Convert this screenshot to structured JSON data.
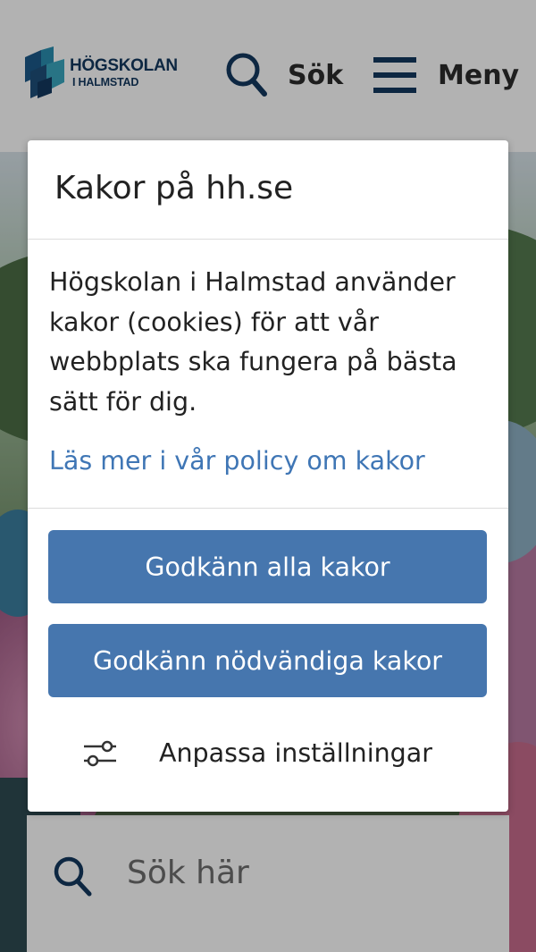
{
  "header": {
    "logo": {
      "line1": "HÖGSKOLAN",
      "line2": "I HALMSTAD"
    },
    "search_label": "Sök",
    "menu_label": "Meny"
  },
  "hero": {
    "search_placeholder": "Sök här"
  },
  "cookie_dialog": {
    "title": "Kakor på hh.se",
    "body": "Högskolan i Halmstad använder kakor (cookies) för att vår webbplats ska fungera på bästa sätt för dig.",
    "policy_link": "Läs mer i vår policy om kakor",
    "accept_all_label": "Godkänn alla kakor",
    "accept_necessary_label": "Godkänn nödvändiga kakor",
    "customize_label": "Anpassa inställningar"
  },
  "colors": {
    "brand_navy": "#14395f",
    "button_blue": "#4676ae",
    "link_blue": "#3f76b5",
    "overlay": "rgba(0,0,0,0.30)"
  },
  "icons": {
    "search": "search-icon",
    "menu": "hamburger-menu-icon",
    "customize": "sliders-icon",
    "logo": "hogskolan-logo-mark"
  }
}
